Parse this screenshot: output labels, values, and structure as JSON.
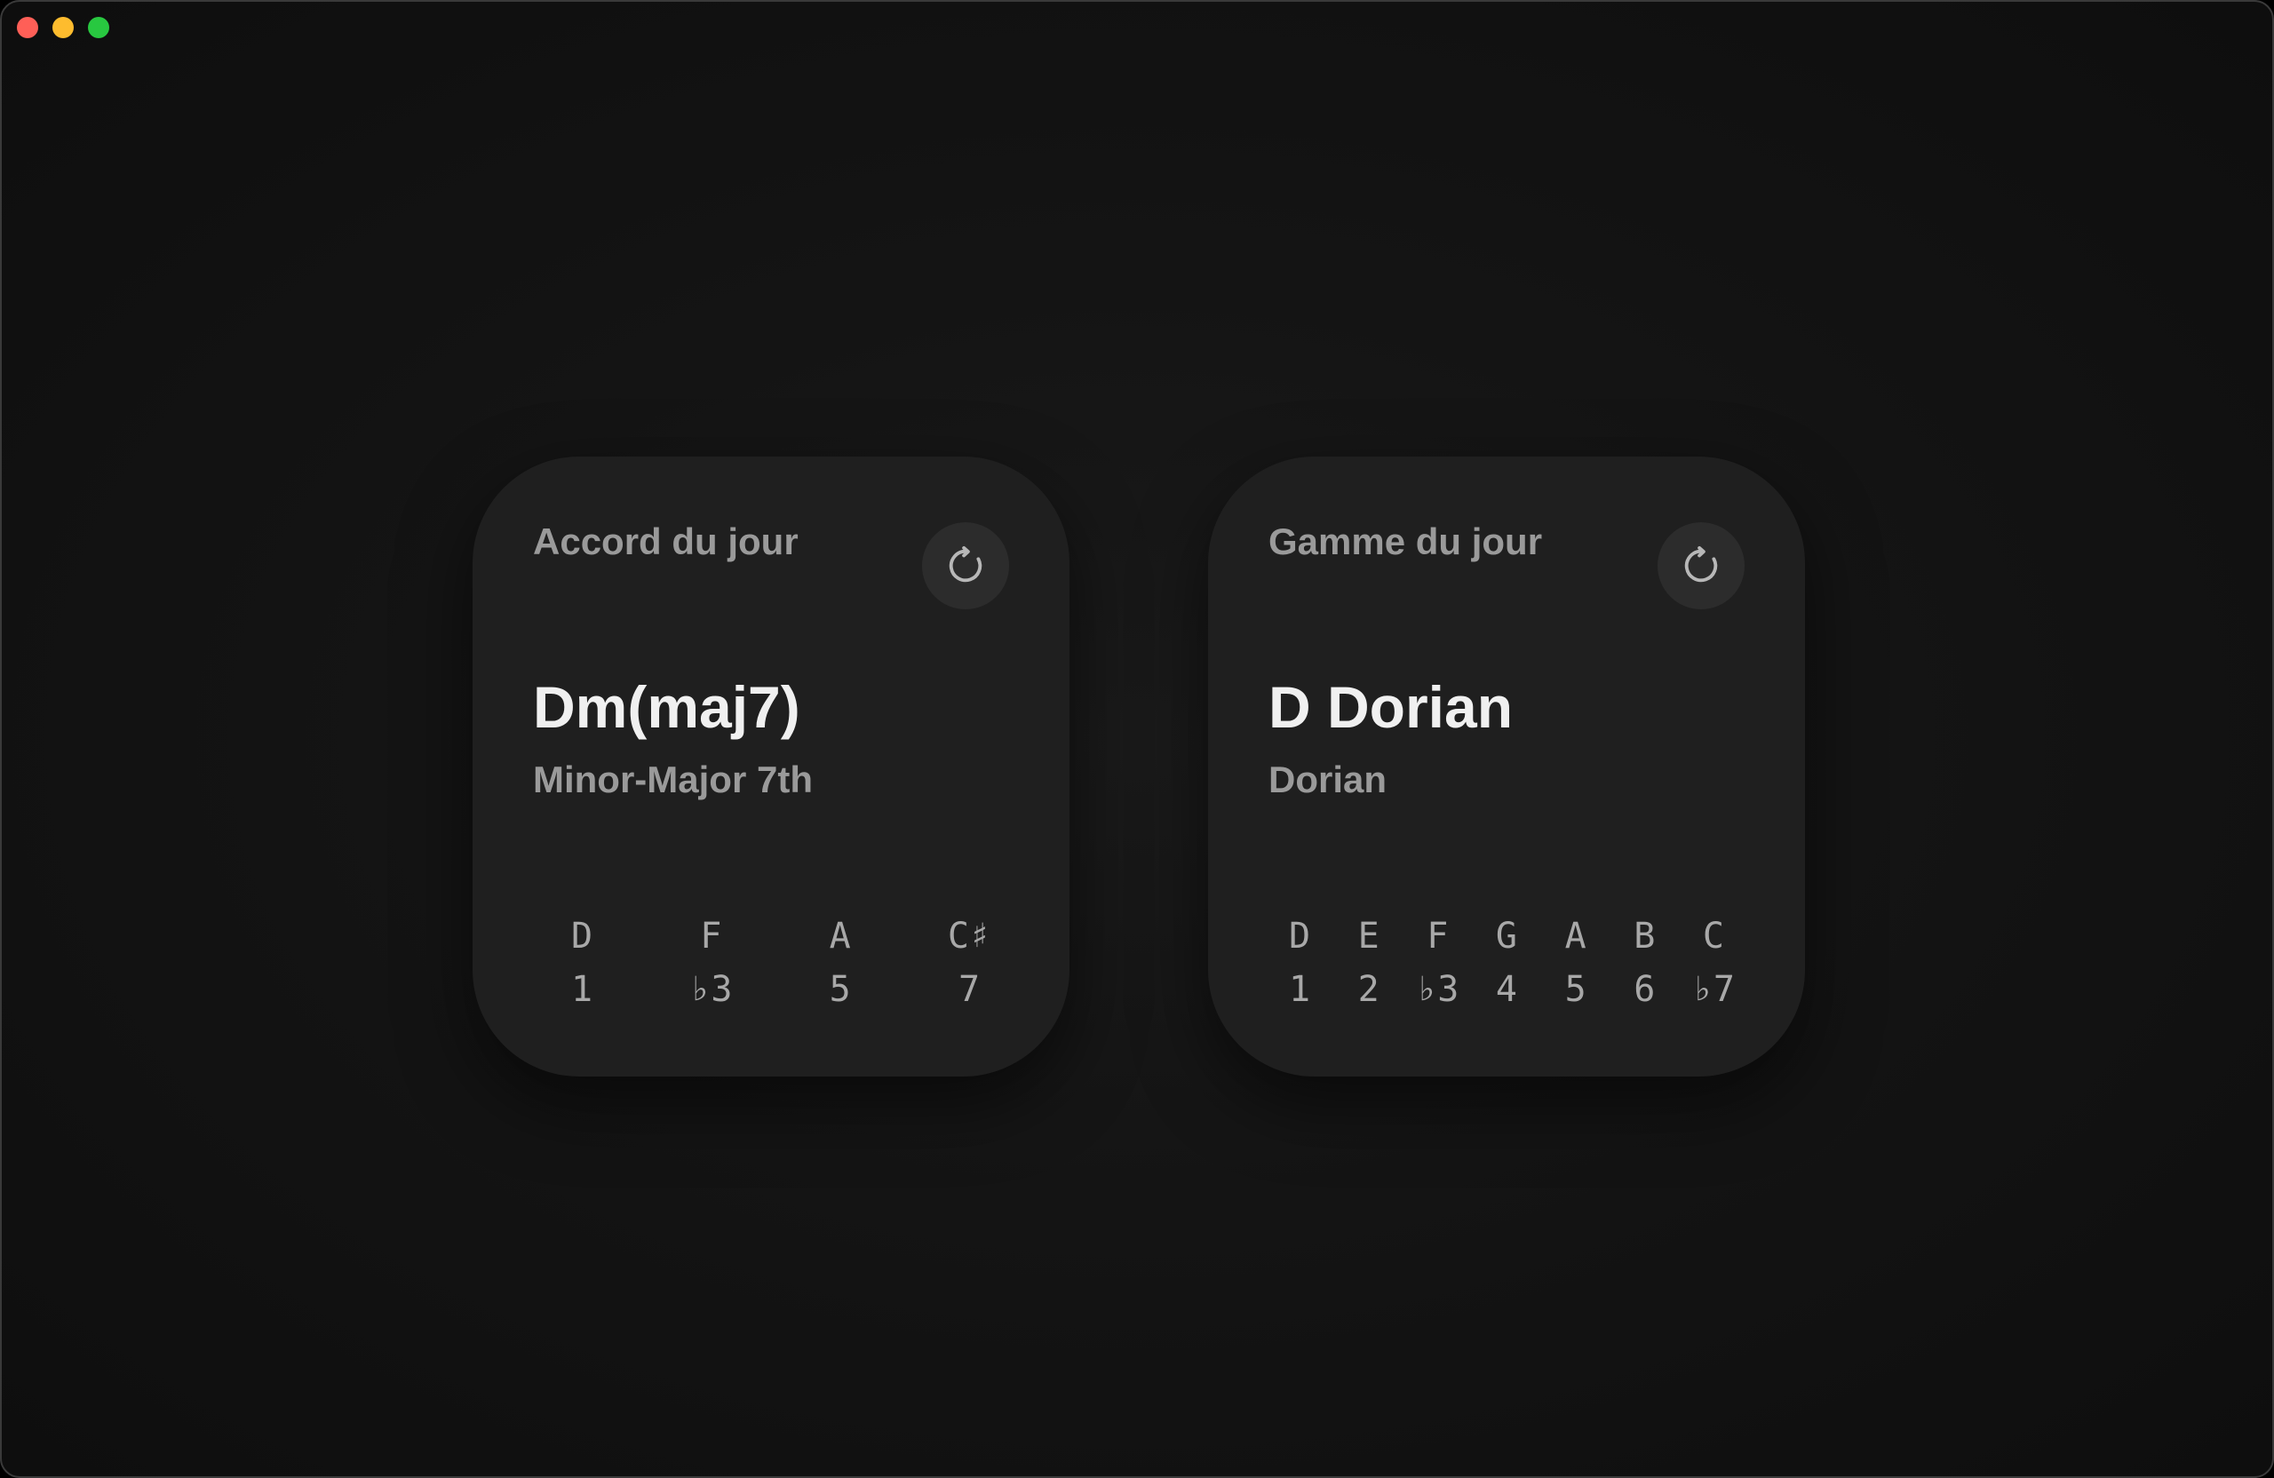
{
  "chord_card": {
    "title": "Accord du jour",
    "name": "Dm(maj7)",
    "quality": "Minor-Major 7th",
    "refresh_icon": "refresh-icon",
    "notes": [
      {
        "name": "D",
        "degree": "1"
      },
      {
        "name": "F",
        "degree": "♭3"
      },
      {
        "name": "A",
        "degree": "5"
      },
      {
        "name": "C♯",
        "degree": "7"
      }
    ]
  },
  "scale_card": {
    "title": "Gamme du jour",
    "name": "D Dorian",
    "mode": "Dorian",
    "refresh_icon": "refresh-icon",
    "notes": [
      {
        "name": "D",
        "degree": "1"
      },
      {
        "name": "E",
        "degree": "2"
      },
      {
        "name": "F",
        "degree": "♭3"
      },
      {
        "name": "G",
        "degree": "4"
      },
      {
        "name": "A",
        "degree": "5"
      },
      {
        "name": "B",
        "degree": "6"
      },
      {
        "name": "C",
        "degree": "♭7"
      }
    ]
  },
  "colors": {
    "background": "#141414",
    "card": "#1f1f1f",
    "title_text": "#9a9a9a",
    "main_text": "#f0f0f0",
    "button": "#2c2c2c",
    "close": "#ff5f57",
    "minimize": "#febc2e",
    "maximize": "#28c840"
  }
}
